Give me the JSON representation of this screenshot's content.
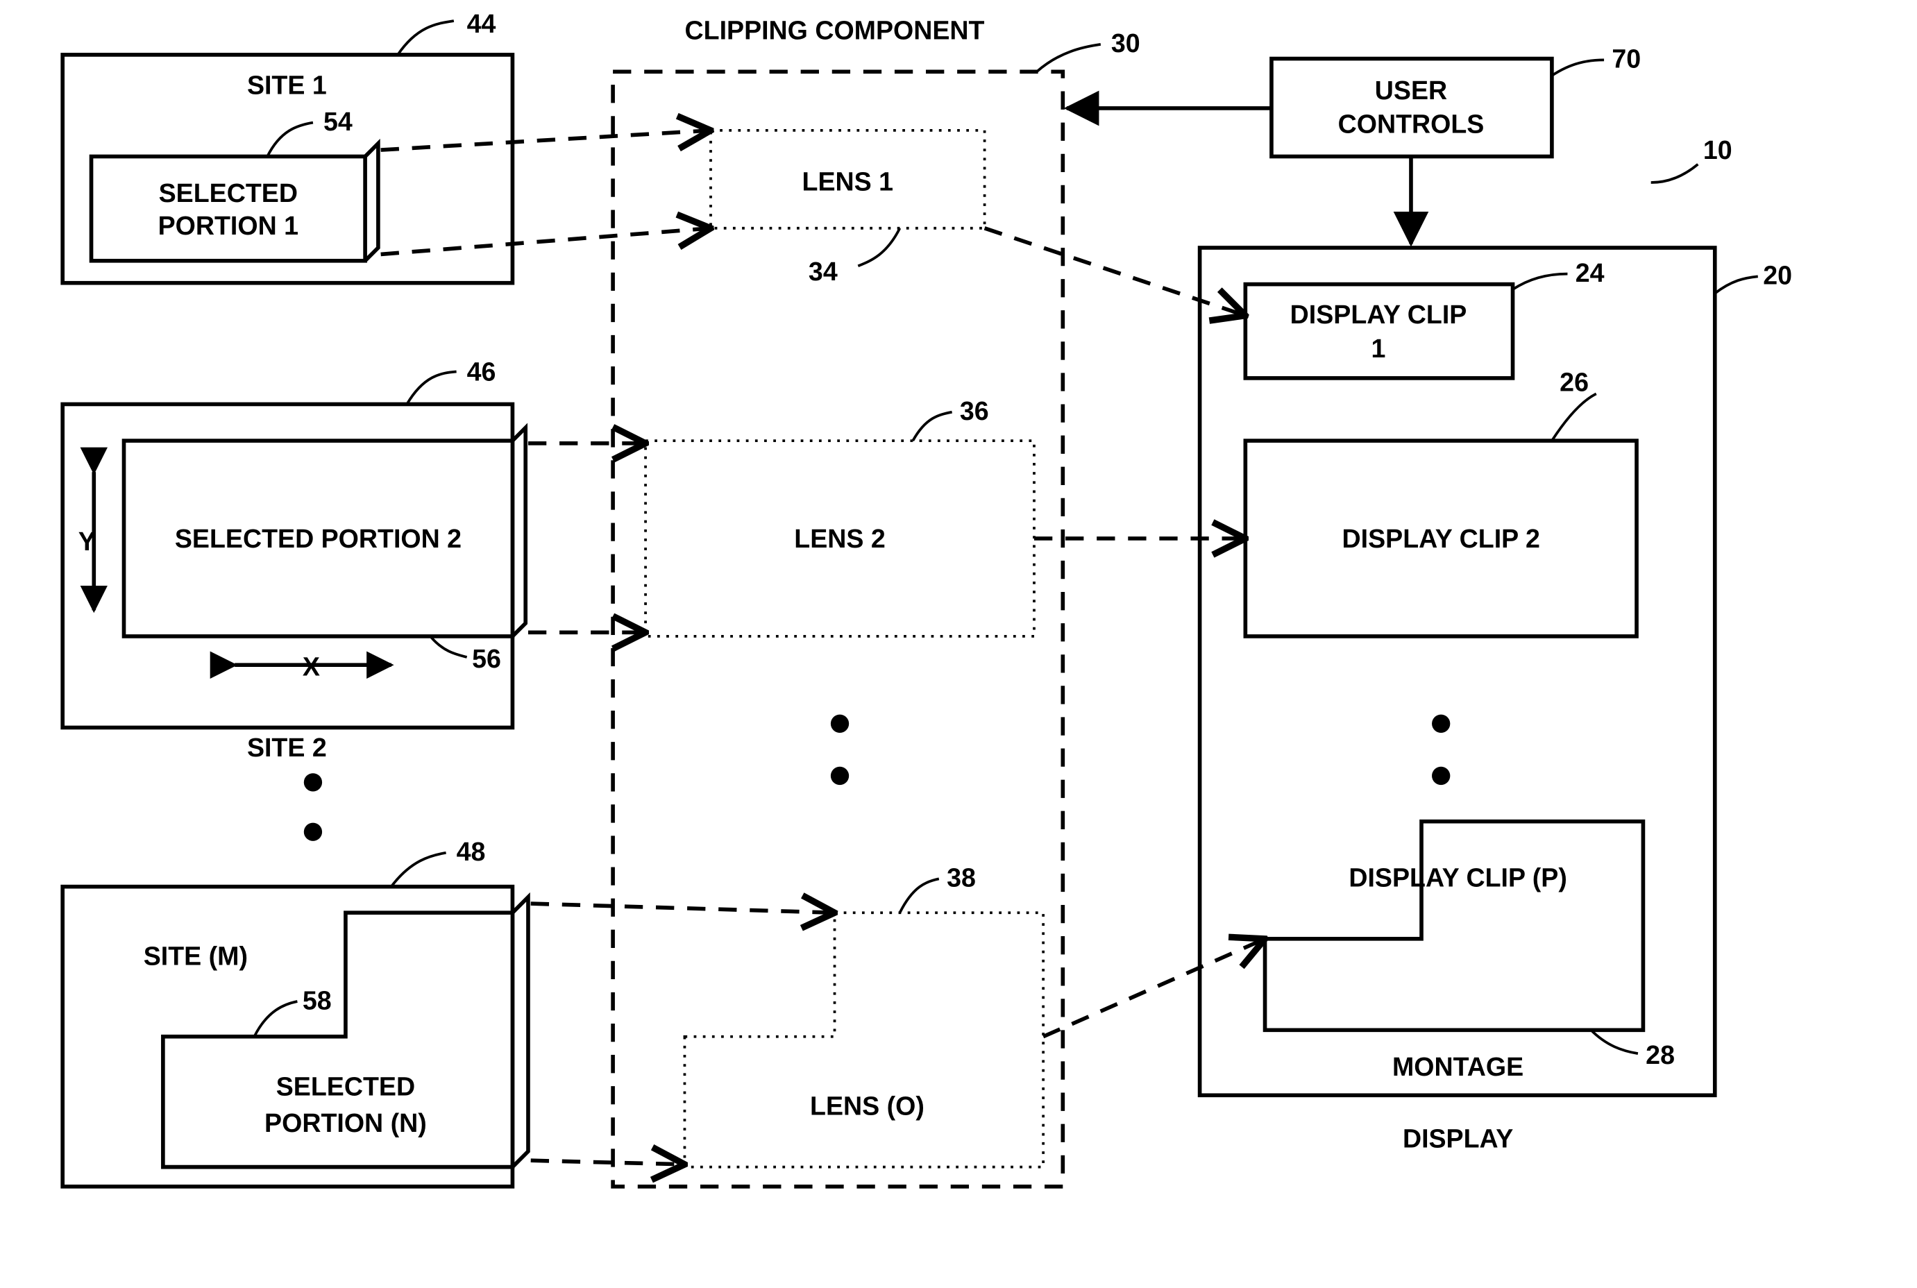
{
  "title": "CLIPPING COMPONENT",
  "refs": {
    "r10": "10",
    "r20": "20",
    "r24": "24",
    "r26": "26",
    "r28": "28",
    "r30": "30",
    "r34": "34",
    "r36": "36",
    "r38": "38",
    "r44": "44",
    "r46": "46",
    "r48": "48",
    "r54": "54",
    "r56": "56",
    "r58": "58",
    "r70": "70"
  },
  "sites": {
    "site1": {
      "title": "SITE 1",
      "portion": "SELECTED PORTION 1"
    },
    "site2": {
      "title": "SITE 2",
      "portion": "SELECTED PORTION 2",
      "x": "X",
      "y": "Y"
    },
    "siteM": {
      "title": "SITE (M)",
      "portion_line1": "SELECTED",
      "portion_line2": "PORTION (N)"
    }
  },
  "lenses": {
    "l1": "LENS 1",
    "l2": "LENS 2",
    "lO": "LENS (O)"
  },
  "display": {
    "label": "DISPLAY",
    "montage": "MONTAGE",
    "clip1_line1": "DISPLAY CLIP",
    "clip1_line2": "1",
    "clip2": "DISPLAY CLIP 2",
    "clipP": "DISPLAY CLIP (P)"
  },
  "controls": {
    "label_line1": "USER",
    "label_line2": "CONTROLS"
  }
}
